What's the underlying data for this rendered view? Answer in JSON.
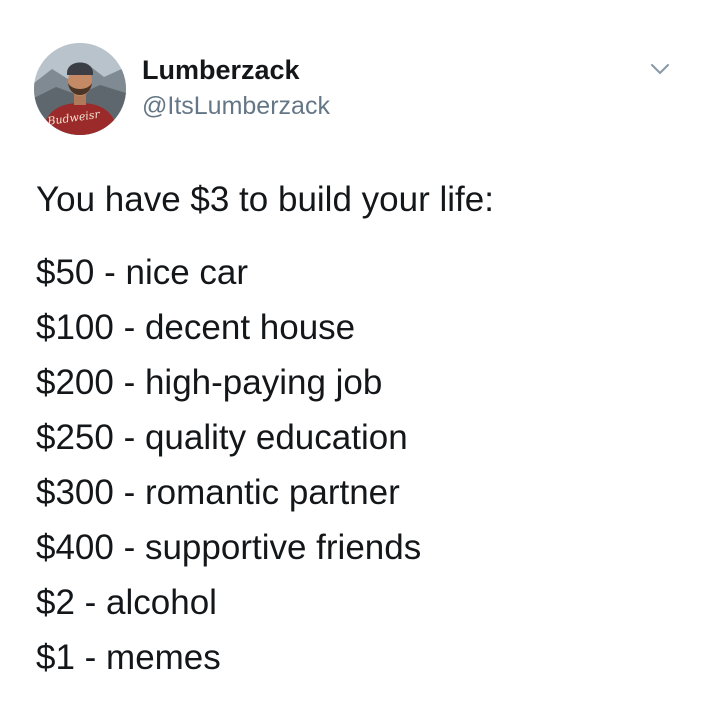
{
  "tweet": {
    "author": {
      "name": "Lumberzack",
      "handle": "@ItsLumberzack",
      "avatar_shirt_text": "Budweiser"
    },
    "intro": "You have $3 to build your life:",
    "items": [
      "$50 - nice car",
      "$100 - decent house",
      "$200 - high-paying job",
      "$250 - quality education",
      "$300 - romantic partner",
      "$400 - supportive friends",
      "$2 - alcohol",
      "$1 - memes"
    ],
    "menu_icon": "chevron-down-icon"
  }
}
